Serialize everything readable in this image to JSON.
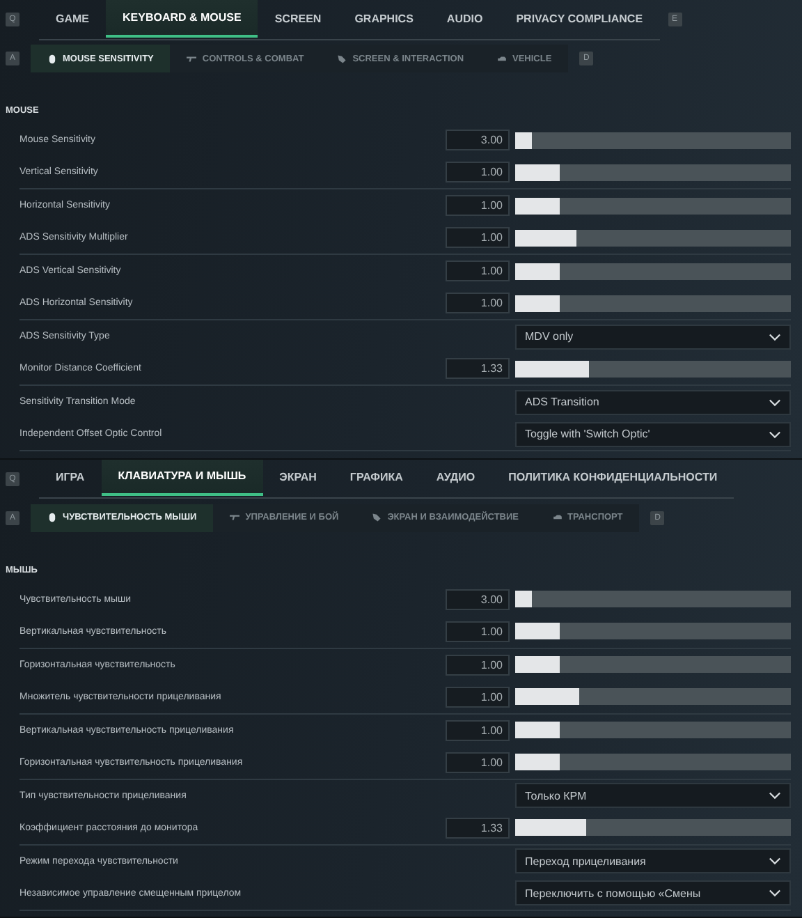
{
  "panels": [
    {
      "key_prev": "Q",
      "key_next": "E",
      "sub_key_prev": "A",
      "sub_key_next": "D",
      "tabs": [
        {
          "label": "GAME",
          "selected": false
        },
        {
          "label": "KEYBOARD & MOUSE",
          "selected": true
        },
        {
          "label": "SCREEN",
          "selected": false
        },
        {
          "label": "GRAPHICS",
          "selected": false
        },
        {
          "label": "AUDIO",
          "selected": false
        },
        {
          "label": "PRIVACY COMPLIANCE",
          "selected": false
        }
      ],
      "subtabs": [
        {
          "label": "MOUSE SENSITIVITY",
          "selected": true
        },
        {
          "label": "CONTROLS & COMBAT",
          "selected": false
        },
        {
          "label": "SCREEN & INTERACTION",
          "selected": false
        },
        {
          "label": "VEHICLE",
          "selected": false
        }
      ],
      "section": "MOUSE",
      "groups": [
        {
          "rows": [
            {
              "kind": "slider",
              "label": "Mouse Sensitivity",
              "value": "3.00",
              "level": 0.06
            },
            {
              "kind": "slider",
              "label": "Vertical Sensitivity",
              "value": "1.00",
              "level": 0.16
            }
          ]
        },
        {
          "rows": [
            {
              "kind": "slider",
              "label": "Horizontal Sensitivity",
              "value": "1.00",
              "level": 0.16
            },
            {
              "kind": "slider",
              "label": "ADS Sensitivity Multiplier",
              "value": "1.00",
              "level": 0.22
            }
          ]
        },
        {
          "rows": [
            {
              "kind": "slider",
              "label": "ADS Vertical Sensitivity",
              "value": "1.00",
              "level": 0.16
            },
            {
              "kind": "slider",
              "label": "ADS Horizontal Sensitivity",
              "value": "1.00",
              "level": 0.16
            }
          ]
        },
        {
          "rows": [
            {
              "kind": "dropdown",
              "label": "ADS Sensitivity Type",
              "value": "MDV only"
            },
            {
              "kind": "slider",
              "label": "Monitor Distance Coefficient",
              "value": "1.33",
              "level": 0.27
            }
          ]
        },
        {
          "rows": [
            {
              "kind": "dropdown",
              "label": "Sensitivity Transition Mode",
              "value": "ADS Transition"
            },
            {
              "kind": "dropdown",
              "label": "Independent Offset Optic Control",
              "value": "Toggle with 'Switch Optic'"
            }
          ]
        }
      ]
    },
    {
      "key_prev": "Q",
      "sub_key_prev": "A",
      "sub_key_next": "D",
      "tabs": [
        {
          "label": "ИГРА",
          "selected": false
        },
        {
          "label": "КЛАВИАТУРА И МЫШЬ",
          "selected": true
        },
        {
          "label": "ЭКРАН",
          "selected": false
        },
        {
          "label": "ГРАФИКА",
          "selected": false
        },
        {
          "label": "АУДИО",
          "selected": false
        },
        {
          "label": "ПОЛИТИКА КОНФИДЕНЦИАЛЬНОСТИ",
          "selected": false
        }
      ],
      "subtabs": [
        {
          "label": "ЧУВСТВИТЕЛЬНОСТЬ МЫШИ",
          "selected": true
        },
        {
          "label": "УПРАВЛЕНИЕ И БОЙ",
          "selected": false
        },
        {
          "label": "ЭКРАН И ВЗАИМОДЕЙСТВИЕ",
          "selected": false
        },
        {
          "label": "ТРАНСПОРТ",
          "selected": false
        }
      ],
      "section": "МЫШЬ",
      "groups": [
        {
          "rows": [
            {
              "kind": "slider",
              "label": "Чувствительность мыши",
              "value": "3.00",
              "level": 0.06
            },
            {
              "kind": "slider",
              "label": "Вертикальная чувствительность",
              "value": "1.00",
              "level": 0.16
            }
          ]
        },
        {
          "rows": [
            {
              "kind": "slider",
              "label": "Горизонтальная чувствительность",
              "value": "1.00",
              "level": 0.16
            },
            {
              "kind": "slider",
              "label": "Множитель чувствительности прицеливания",
              "value": "1.00",
              "level": 0.23
            }
          ]
        },
        {
          "rows": [
            {
              "kind": "slider",
              "label": "Вертикальная чувствительность прицеливания",
              "value": "1.00",
              "level": 0.16
            },
            {
              "kind": "slider",
              "label": "Горизонтальная чувствительность прицеливания",
              "value": "1.00",
              "level": 0.16
            }
          ]
        },
        {
          "rows": [
            {
              "kind": "dropdown",
              "label": "Тип чувствительности прицеливания",
              "value": "Только КРМ"
            },
            {
              "kind": "slider",
              "label": "Коэффициент расстояния до монитора",
              "value": "1.33",
              "level": 0.26
            }
          ]
        },
        {
          "rows": [
            {
              "kind": "dropdown",
              "label": "Режим перехода чувствительности",
              "value": "Переход прицеливания"
            },
            {
              "kind": "dropdown",
              "label": "Независимое управление смещенным прицелом",
              "value": "Переключить с помощью «Смены"
            }
          ]
        }
      ]
    }
  ]
}
